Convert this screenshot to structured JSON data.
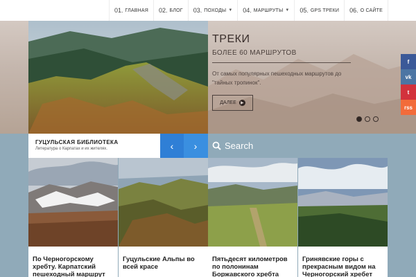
{
  "nav": {
    "items": [
      {
        "num": "01.",
        "label": "ГЛАВНАЯ",
        "caret": false
      },
      {
        "num": "02.",
        "label": "БЛОГ",
        "caret": false
      },
      {
        "num": "03.",
        "label": "ПОХОДЫ",
        "caret": true
      },
      {
        "num": "04.",
        "label": "МАРШРУТЫ",
        "caret": true
      },
      {
        "num": "05.",
        "label": "GPS ТРЕКИ",
        "caret": false
      },
      {
        "num": "06.",
        "label": "О САЙТЕ",
        "caret": false
      }
    ]
  },
  "hero": {
    "title": "ТРЕКИ",
    "subtitle": "БОЛЕЕ 60 МАРШРУТОВ",
    "description": "От самых популярных пешеходных маршрутов до \"тайных тропинок\".",
    "button_label": "ДАЛЕЕ",
    "slides_count": 3,
    "active_slide": 1
  },
  "social": [
    {
      "name": "facebook",
      "glyph": "f",
      "color": "#3b5998"
    },
    {
      "name": "vk",
      "glyph": "vk",
      "color": "#4c75a3"
    },
    {
      "name": "twitter",
      "glyph": "t",
      "color": "#d2323c"
    },
    {
      "name": "rss",
      "glyph": "rss",
      "color": "#f26b3a"
    }
  ],
  "library": {
    "title": "ГУЦУЛЬСКАЯ БИБЛИОТЕКА",
    "subtitle": "Литература о Карпатах и их жителях."
  },
  "search": {
    "placeholder": "Search"
  },
  "cards": [
    {
      "title": "По Черногорскому хребту. Карпатский пешеходный маршрут №1"
    },
    {
      "title": "Гуцульские Альпы во всей красе"
    },
    {
      "title": "Пятьдесят километров по полонинам Боржавского хребта"
    },
    {
      "title": "Гринявские горы с прекрасным видом на Черногорский хребет"
    }
  ],
  "colors": {
    "band": "#90aab9",
    "arrows_blue": "#3a8fe0"
  }
}
